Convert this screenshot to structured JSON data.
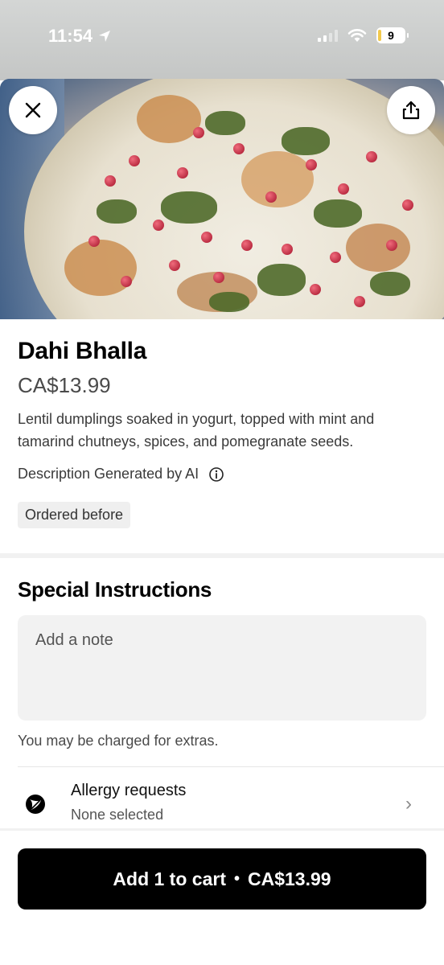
{
  "status_bar": {
    "time": "11:54",
    "battery": "9"
  },
  "item": {
    "name": "Dahi Bhalla",
    "price": "CA$13.99",
    "description": "Lentil dumplings soaked in yogurt, topped with mint and tamarind chutneys, spices, and pomegranate seeds.",
    "ai_note": "Description Generated by AI",
    "badge": "Ordered before"
  },
  "special_instructions": {
    "title": "Special Instructions",
    "placeholder": "Add a note",
    "extras_note": "You may be charged for extras."
  },
  "allergy": {
    "title": "Allergy requests",
    "subtitle": "None selected"
  },
  "cart_button": {
    "label": "Add 1 to cart",
    "separator": "•",
    "price": "CA$13.99"
  }
}
